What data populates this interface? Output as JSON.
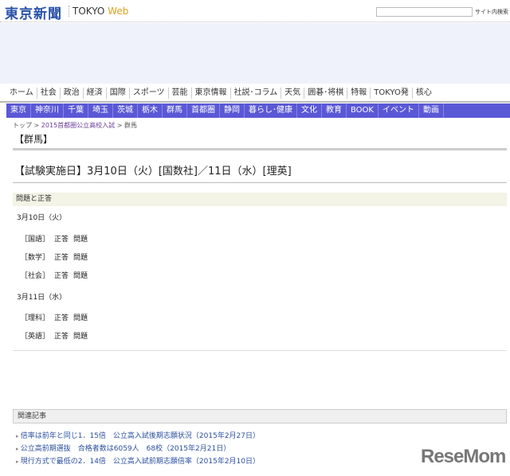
{
  "header": {
    "logo": "東京新聞",
    "brand_a": "TOKYO",
    "brand_b": "Web",
    "search_placeholder": "",
    "search_button": "サイト内検索"
  },
  "nav_main": [
    "ホーム",
    "社会",
    "政治",
    "経済",
    "国際",
    "スポーツ",
    "芸能",
    "東京情報",
    "社説･コラム",
    "天気",
    "囲碁･将棋",
    "特報",
    "TOKYO発",
    "核心"
  ],
  "nav_region": [
    "東京",
    "神奈川",
    "千葉",
    "埼玉",
    "茨城",
    "栃木",
    "群馬",
    "首都圏",
    "静岡",
    "暮らし･健康",
    "文化",
    "教育",
    "BOOK",
    "イベント",
    "動画"
  ],
  "breadcrumb": {
    "top": "トップ",
    "sep": " > ",
    "section": "2015首都圏公立高校入試",
    "current": "群馬"
  },
  "page_title": "【群馬】",
  "exam_heading": "【試験実施日】3月10日（火）[国数社]／11日（水）[理英]",
  "section_label": "問題と正答",
  "days": [
    {
      "date": "3月10日（火）",
      "subjects": [
        {
          "name": "［国語］",
          "answer": "正答",
          "question": "問題"
        },
        {
          "name": "［数学］",
          "answer": "正答",
          "question": "問題"
        },
        {
          "name": "［社会］",
          "answer": "正答",
          "question": "問題"
        }
      ]
    },
    {
      "date": "3月11日（水）",
      "subjects": [
        {
          "name": "［理科］",
          "answer": "正答",
          "question": "問題"
        },
        {
          "name": "［英語］",
          "answer": "正答",
          "question": "問題"
        }
      ]
    }
  ],
  "related": {
    "title": "関連記事",
    "links": [
      "倍率は前年と同じ1．15倍　公立高入試後期志願状況（2015年2月27日）",
      "公立高前期選抜　合格者数は6059人　68校（2015年2月21日）",
      "現行方式で最低の2．14倍　公立高入試前期志願倍率（2015年2月10日）"
    ]
  },
  "watermark": "ReseMom"
}
